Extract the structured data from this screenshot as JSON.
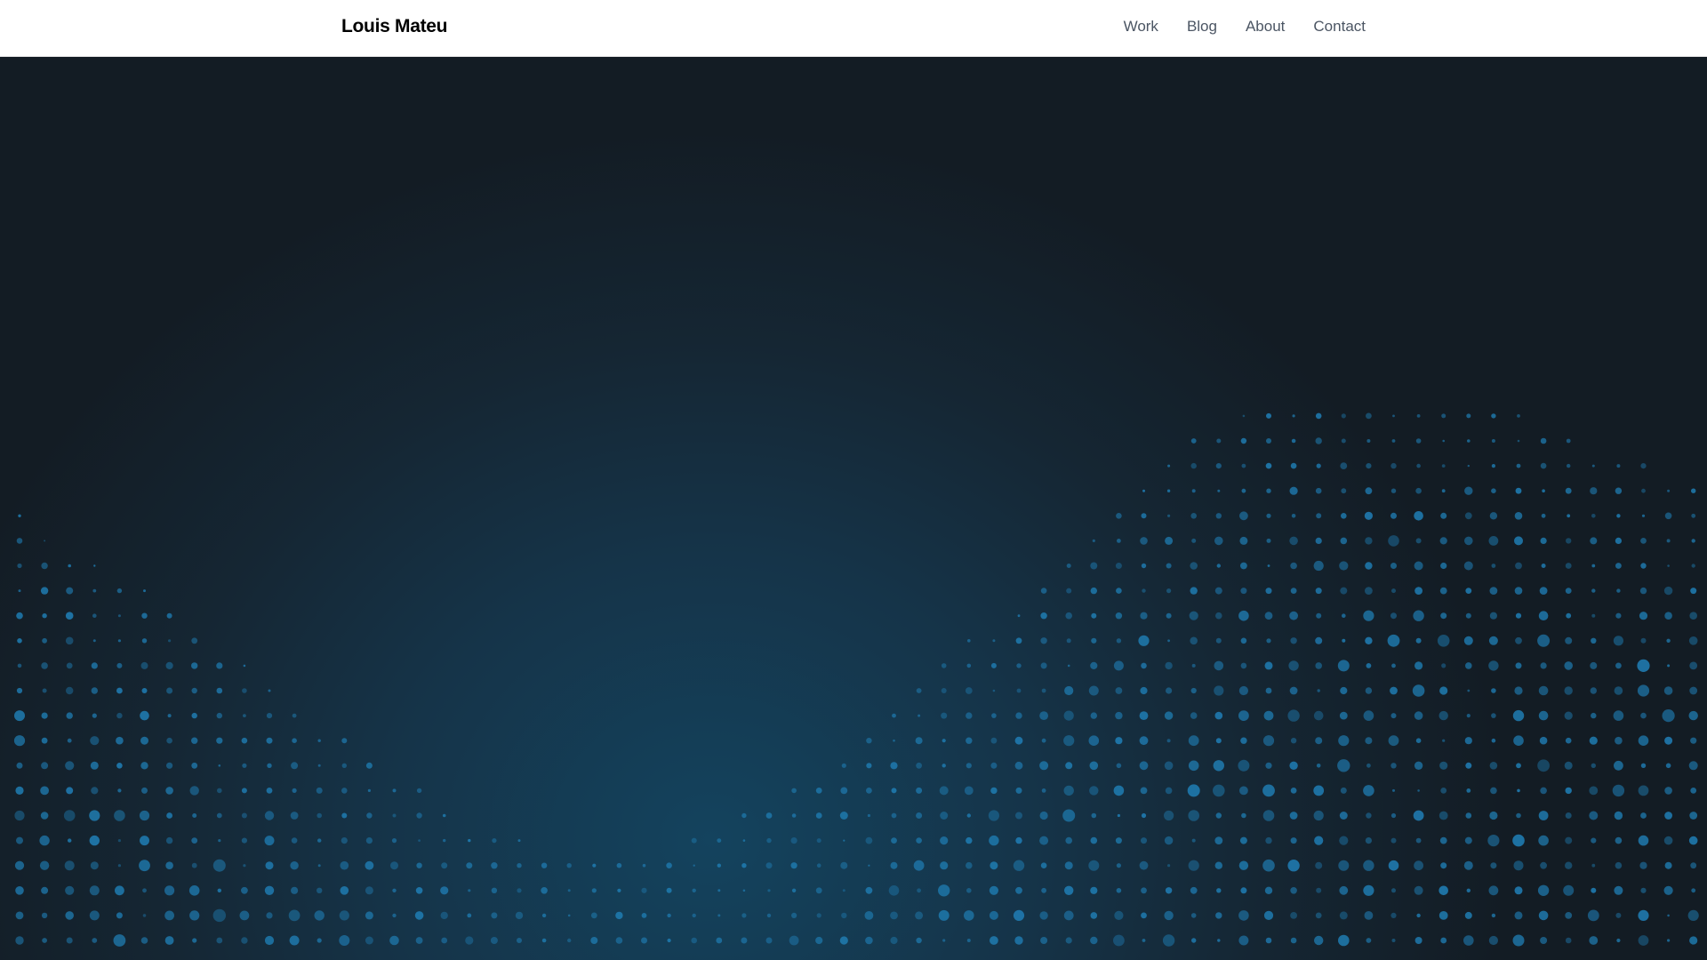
{
  "header": {
    "brand": "Louis Mateu",
    "nav": [
      {
        "label": "Work"
      },
      {
        "label": "Blog"
      },
      {
        "label": "About"
      },
      {
        "label": "Contact"
      }
    ]
  },
  "hero": {
    "dot_color": "#1f7bb0",
    "background_center": "#14435e",
    "background_edge": "#131c24"
  }
}
